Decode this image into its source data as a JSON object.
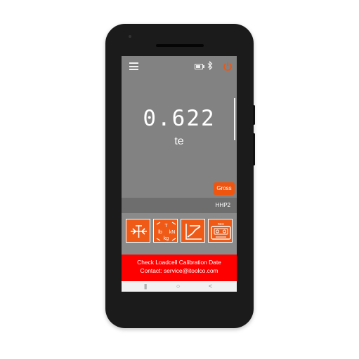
{
  "status_bar": {
    "icons": [
      "menu-icon",
      "battery-icon",
      "bluetooth-icon",
      "power-icon"
    ]
  },
  "display": {
    "value": "0.622",
    "unit": "te"
  },
  "gross_button": {
    "label": "Gross"
  },
  "device": {
    "name": "HHP2"
  },
  "toolbar": {
    "zero_button": {
      "icon": "tare-zero-icon"
    },
    "units_button": {
      "icon": "unit-select-icon",
      "labels": [
        "T",
        "lb",
        "kN",
        "kg"
      ]
    },
    "graph_button": {
      "icon": "graph-icon"
    },
    "recorder_button": {
      "icon": "recorder-icon",
      "label": "REC"
    }
  },
  "alert": {
    "line1": "Check Loadcell Calibration Date",
    "line2": "Contact: service@itoolco.com"
  },
  "nav_bar": {
    "recents": "|||",
    "home": "○",
    "back": "<"
  },
  "colors": {
    "accent": "#ef5a16",
    "alert": "#ff0000",
    "screen": "#828282"
  }
}
